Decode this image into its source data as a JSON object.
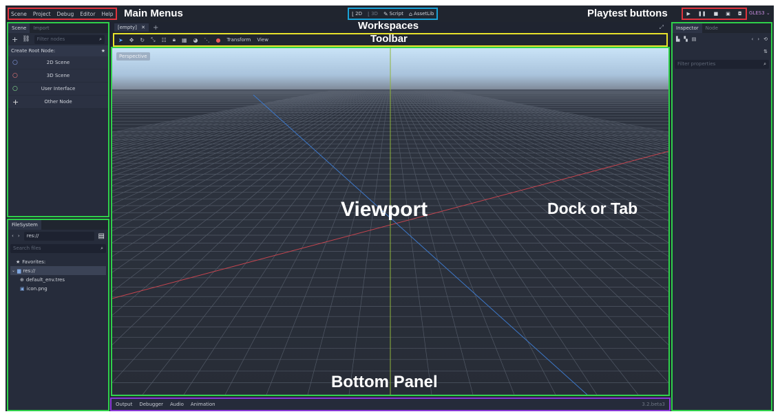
{
  "menus": [
    "Scene",
    "Project",
    "Debug",
    "Editor",
    "Help"
  ],
  "annotations": {
    "main_menus": "Main Menus",
    "workspaces": "Workspaces",
    "playtest": "Playtest buttons",
    "toolbar": "Toolbar",
    "viewport": "Viewport",
    "dock": "Dock or Tab",
    "bottom_panel": "Bottom Panel"
  },
  "workspaces": [
    {
      "icon": "2d-icon",
      "label": "2D",
      "active": true
    },
    {
      "icon": "3d-icon",
      "label": "3D",
      "active": false
    },
    {
      "icon": "script-icon",
      "label": "Script",
      "active": true
    },
    {
      "icon": "assetlib-icon",
      "label": "AssetLib",
      "active": true
    }
  ],
  "playtest_buttons": [
    "play-icon",
    "pause-icon",
    "stop-icon",
    "play-scene-icon",
    "play-custom-scene-icon"
  ],
  "renderer": "GLES3",
  "scene_dock": {
    "tabs": [
      "Scene",
      "Import"
    ],
    "filter_placeholder": "Filter nodes",
    "create_root_label": "Create Root Node:",
    "nodes": [
      {
        "label": "2D Scene",
        "color": "#8da5f3"
      },
      {
        "label": "3D Scene",
        "color": "#fc7f7f"
      },
      {
        "label": "User Interface",
        "color": "#8eef97"
      },
      {
        "label": "Other Node",
        "color": "#e0e0e0"
      }
    ]
  },
  "filesystem_dock": {
    "tabs": [
      "FileSystem"
    ],
    "path": "res://",
    "search_placeholder": "Search files",
    "tree": [
      {
        "label": "Favorites:",
        "icon": "star-icon"
      },
      {
        "label": "res://",
        "icon": "folder-icon",
        "selected": true
      },
      {
        "label": "default_env.tres",
        "icon": "environment-icon"
      },
      {
        "label": "icon.png",
        "icon": "image-icon"
      }
    ]
  },
  "scene_tabs": {
    "current": "[empty]"
  },
  "toolbar": {
    "transform": "Transform",
    "view": "View"
  },
  "viewport": {
    "mode_label": "Perspective"
  },
  "inspector": {
    "tabs": [
      "Inspector",
      "Node"
    ],
    "filter_placeholder": "Filter properties"
  },
  "bottom_panel": {
    "tabs": [
      "Output",
      "Debugger",
      "Audio",
      "Animation"
    ],
    "version": "3.2.beta3"
  }
}
